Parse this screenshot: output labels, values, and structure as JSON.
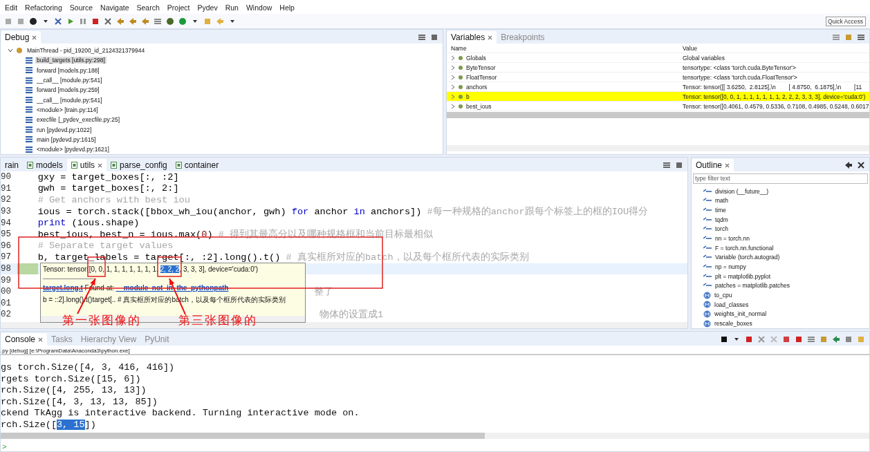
{
  "menu": [
    "Edit",
    "Refactoring",
    "Source",
    "Navigate",
    "Search",
    "Project",
    "Pydev",
    "Run",
    "Window",
    "Help"
  ],
  "quick_access": {
    "placeholder": "Quick Access"
  },
  "debug": {
    "title": "Debug",
    "thread": {
      "label": "MainThread - pid_19200_id_2124321379944",
      "expanded": true
    },
    "frames": [
      {
        "label": "build_targets [utils.py:298]",
        "selected": true
      },
      {
        "label": "forward [models.py:188]",
        "selected": false
      },
      {
        "label": "__call__ [module.py:541]",
        "selected": false
      },
      {
        "label": "forward [models.py:259]",
        "selected": false
      },
      {
        "label": "__call__ [module.py:541]",
        "selected": false
      },
      {
        "label": "<module> [train.py:114]",
        "selected": false
      },
      {
        "label": "execfile [_pydev_execfile.py:25]",
        "selected": false
      },
      {
        "label": "run [pydevd.py:1022]",
        "selected": false
      },
      {
        "label": "main [pydevd.py:1615]",
        "selected": false
      },
      {
        "label": "<module> [pydevd.py:1621]",
        "selected": false
      }
    ]
  },
  "variables": {
    "tabs": [
      {
        "label": "Variables",
        "selected": true
      },
      {
        "label": "Breakpoints",
        "selected": false
      }
    ],
    "columns": [
      "Name",
      "Value"
    ],
    "rows": [
      {
        "name": "Globals",
        "value": "Global variables",
        "selected": false
      },
      {
        "name": "ByteTensor",
        "value": "tensortype: <class 'torch.cuda.ByteTensor'>",
        "selected": false
      },
      {
        "name": "FloatTensor",
        "value": "tensortype: <class 'torch.cuda.FloatTensor'>",
        "selected": false
      },
      {
        "name": "anchors",
        "value": "Tensor: tensor([[ 3.6250,  2.8125],\\n        [ 4.8750,  6.1875],\\n        [11",
        "selected": false
      },
      {
        "name": "b",
        "value": "Tensor: tensor([0, 0, 1, 1, 1, 1, 1, 1, 1, 2, 2, 2, 3, 3, 3], device='cuda:0')",
        "selected": true
      },
      {
        "name": "best_ious",
        "value": "Tensor: tensor([0.4061, 0.4579, 0.5336, 0.7108, 0.4985, 0.5248, 0.6017",
        "selected": false
      }
    ]
  },
  "editor": {
    "tabs": [
      {
        "label": "rain",
        "selected": false
      },
      {
        "label": "models",
        "selected": false
      },
      {
        "label": "utils",
        "selected": true
      },
      {
        "label": "parse_config",
        "selected": false
      },
      {
        "label": "container",
        "selected": false
      }
    ],
    "lines": [
      {
        "number": "90",
        "current": false,
        "tokens": [
          {
            "kind": "code",
            "text": "    gxy = target_boxes[:, :2]"
          }
        ]
      },
      {
        "number": "91",
        "current": false,
        "tokens": [
          {
            "kind": "code",
            "text": "    gwh = target_boxes[:, 2:]"
          }
        ]
      },
      {
        "number": "92",
        "current": false,
        "tokens": [
          {
            "kind": "comment",
            "text": "    # Get anchors with best iou"
          }
        ]
      },
      {
        "number": "93",
        "current": false,
        "tokens": [
          {
            "kind": "code",
            "text": "    ious = torch.stack([bbox_wh_iou(anchor, gwh) "
          },
          {
            "kind": "keyword",
            "text": "for"
          },
          {
            "kind": "code",
            "text": " anchor "
          },
          {
            "kind": "keyword",
            "text": "in"
          },
          {
            "kind": "code",
            "text": " anchors]) "
          },
          {
            "kind": "comment",
            "text": "#每一种规格的anchor跟每个标签上的框的IOU得分"
          }
        ]
      },
      {
        "number": "94",
        "current": false,
        "tokens": [
          {
            "kind": "keyword",
            "text": "    print"
          },
          {
            "kind": "code",
            "text": " (ious.shape)"
          }
        ]
      },
      {
        "number": "95",
        "current": false,
        "tokens": [
          {
            "kind": "code",
            "text": "    best_ious, best_n = ious.max("
          },
          {
            "kind": "number",
            "text": "0"
          },
          {
            "kind": "code",
            "text": ") "
          },
          {
            "kind": "comment",
            "text": "# 得到其最高分以及哪种规格框和当前目标最相似"
          }
        ]
      },
      {
        "number": "96",
        "current": false,
        "tokens": [
          {
            "kind": "comment",
            "text": "    # Separate target values"
          }
        ]
      },
      {
        "number": "97",
        "current": false,
        "tokens": [
          {
            "kind": "code",
            "text": "    b, target_labels = target[:, :2].long().t() "
          },
          {
            "kind": "comment",
            "text": "# 真实框所对应的batch，以及每个框所代表的实际类别"
          }
        ]
      },
      {
        "number": "98",
        "current": true
      },
      {
        "number": "99",
        "current": false
      },
      {
        "number": "00",
        "current": false,
        "tokens": [
          {
            "kind": "fragment",
            "text": "整了"
          }
        ]
      },
      {
        "number": "01",
        "current": false
      },
      {
        "number": "02",
        "current": false,
        "tokens": [
          {
            "kind": "fragment",
            "text": "物体的设置成1"
          }
        ]
      }
    ],
    "tooltip": {
      "value_parts": [
        {
          "text": "Tensor: tensor([0, 0, 1, 1, 1, 1, 1, 1, 1, ",
          "selected": false
        },
        {
          "text": "2, 2, 2",
          "selected": true
        },
        {
          "text": ", 3, 3, 3], device='cuda:0')",
          "selected": false
        }
      ],
      "source": {
        "name": "target.long.t",
        "label": "Found at:",
        "location": "__module_not_in_the_pythonpath"
      },
      "doc": "b = ::2].long().t()target[.. # 真实框所对应的batch，以及每个框所代表的实际类别"
    }
  },
  "outline": {
    "title": "Outline",
    "filter": {
      "placeholder": "type filter text"
    },
    "items": [
      {
        "kind": "import",
        "label": "division (__future__)"
      },
      {
        "kind": "import",
        "label": "math"
      },
      {
        "kind": "import",
        "label": "time"
      },
      {
        "kind": "import",
        "label": "tqdm"
      },
      {
        "kind": "import",
        "label": "torch"
      },
      {
        "kind": "import",
        "label": "nn = torch.nn"
      },
      {
        "kind": "import",
        "label": "F = torch.nn.functional"
      },
      {
        "kind": "import",
        "label": "Variable (torch.autograd)"
      },
      {
        "kind": "import",
        "label": "np = numpy"
      },
      {
        "kind": "import",
        "label": "plt = matplotlib.pyplot"
      },
      {
        "kind": "import",
        "label": "patches = matplotlib.patches"
      },
      {
        "kind": "method",
        "label": "to_cpu"
      },
      {
        "kind": "method",
        "label": "load_classes"
      },
      {
        "kind": "method",
        "label": "weights_init_normal"
      },
      {
        "kind": "method",
        "label": "rescale_boxes"
      }
    ]
  },
  "console": {
    "tabs": [
      {
        "label": "Console",
        "selected": true
      },
      {
        "label": "Tasks",
        "selected": false
      },
      {
        "label": "Hierarchy View",
        "selected": false
      },
      {
        "label": "PyUnit",
        "selected": false
      }
    ],
    "process": ".py [debug] [e:\\ProgramData\\Anaconda3\\python.exe]",
    "lines": [
      [
        {
          "text": "gs torch.Size([4, 3, 416, 416])",
          "selected": false
        }
      ],
      [
        {
          "text": "rgets torch.Size([15, 6])",
          "selected": false
        }
      ],
      [
        {
          "text": "rch.Size([4, 255, 13, 13])",
          "selected": false
        }
      ],
      [
        {
          "text": "rch.Size([4, 3, 13, 13, 85])",
          "selected": false
        }
      ],
      [
        {
          "text": "ckend TkAgg is interactive backend. Turning interactive mode on.",
          "selected": false
        }
      ],
      [
        {
          "text": "rch.Size([",
          "selected": false
        },
        {
          "text": "3, 15",
          "selected": true
        },
        {
          "text": "])",
          "selected": false
        }
      ]
    ],
    "prompt": ">"
  },
  "annotations": [
    {
      "text": "第一张图像的"
    },
    {
      "text": "第三张图像的"
    }
  ]
}
